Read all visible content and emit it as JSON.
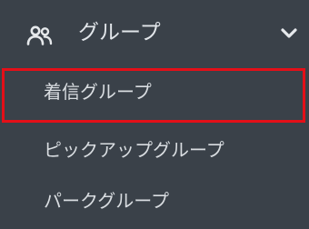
{
  "menu": {
    "group": {
      "label": "グループ",
      "icon": "group-users-icon",
      "toggle_icon": "chevron-down-icon"
    },
    "items": [
      {
        "label": "着信グループ",
        "selected": true
      },
      {
        "label": "ピックアップグループ",
        "selected": false
      },
      {
        "label": "パークグループ",
        "selected": false
      }
    ]
  },
  "colors": {
    "background": "#3a4149",
    "text": "#d9dde1",
    "highlight_border": "#e40f18"
  }
}
